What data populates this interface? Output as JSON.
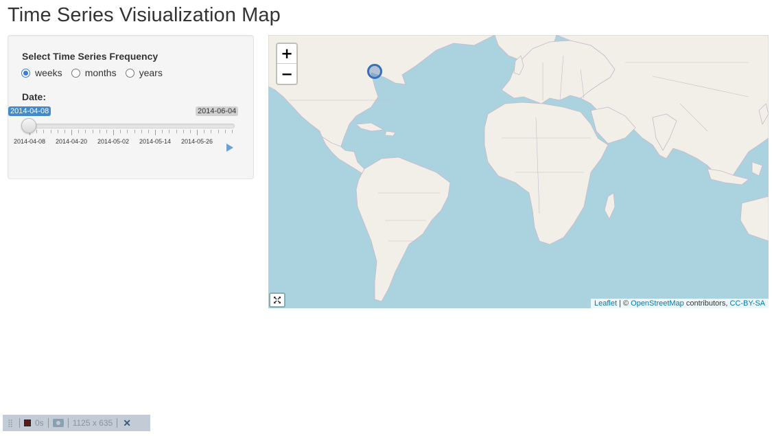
{
  "page": {
    "title": "Time Series Visiualization Map"
  },
  "controls": {
    "frequency_label": "Select Time Series Frequency",
    "frequency_options": [
      "weeks",
      "months",
      "years"
    ],
    "frequency_selected": "weeks",
    "date_label": "Date:",
    "slider": {
      "from_value": "2014-04-08",
      "max_value": "2014-06-04",
      "tick_labels": [
        "2014-04-08",
        "2014-04-20",
        "2014-05-02",
        "2014-05-14",
        "2014-05-26"
      ],
      "position": 0.0
    }
  },
  "map": {
    "zoom_in": "+",
    "zoom_out": "−",
    "attribution": {
      "leaflet": "Leaflet",
      "sep": " | © ",
      "osm": "OpenStreetMap",
      "contributors": " contributors, ",
      "license": "CC-BY-SA"
    },
    "colors": {
      "water": "#aad3df",
      "land": "#f2efe9",
      "border": "#c9b8c9",
      "marker": "#3a6fb7"
    }
  },
  "recorder": {
    "time": "0s",
    "size": "1125 x 635",
    "close": "✕"
  }
}
